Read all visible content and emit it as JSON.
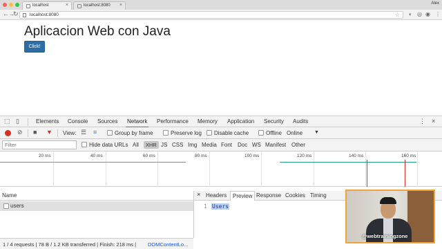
{
  "browser": {
    "tabs": [
      {
        "label": "localhost"
      },
      {
        "label": "localhost:8080"
      }
    ],
    "profile": "Alex",
    "url": "localhost:8080",
    "traffic_colors": [
      "#fc605c",
      "#fdbc40",
      "#34c84a"
    ]
  },
  "page": {
    "title": "Aplicacion Web con Java",
    "button_label": "Click!",
    "button_color": "#337ab7"
  },
  "devtools": {
    "tabs": [
      "Elements",
      "Console",
      "Sources",
      "Network",
      "Performance",
      "Memory",
      "Application",
      "Security",
      "Audits"
    ],
    "active_tab": "Network",
    "toolbar": {
      "view_label": "View:",
      "group_by_frame": "Group by frame",
      "preserve_log": "Preserve log",
      "disable_cache": "Disable cache",
      "offline": "Offline",
      "throttle": "Online"
    },
    "filter": {
      "placeholder": "Filter",
      "hide_data_urls": "Hide data URLs",
      "types": [
        "All",
        "XHR",
        "JS",
        "CSS",
        "Img",
        "Media",
        "Font",
        "Doc",
        "WS",
        "Manifest",
        "Other"
      ],
      "active_type": "XHR"
    },
    "timeline": {
      "labels": [
        "20 ms",
        "40 ms",
        "60 ms",
        "80 ms",
        "100 ms",
        "120 ms",
        "140 ms",
        "160 ms"
      ]
    },
    "requests": {
      "column_name": "Name",
      "rows": [
        {
          "name": "users"
        }
      ]
    },
    "detail": {
      "tabs": [
        "Headers",
        "Preview",
        "Response",
        "Cookies",
        "Timing"
      ],
      "active_tab": "Preview",
      "line_number": "1",
      "line_text": "Users"
    },
    "status": {
      "summary": "1 / 4 requests | 78 B / 1.2 KB transferred | Finish: 218 ms | ",
      "dcl": "DOMContentLo..."
    }
  },
  "webcam": {
    "watermark": "@webtrainingzone",
    "frame_color": "#f0a23b"
  }
}
